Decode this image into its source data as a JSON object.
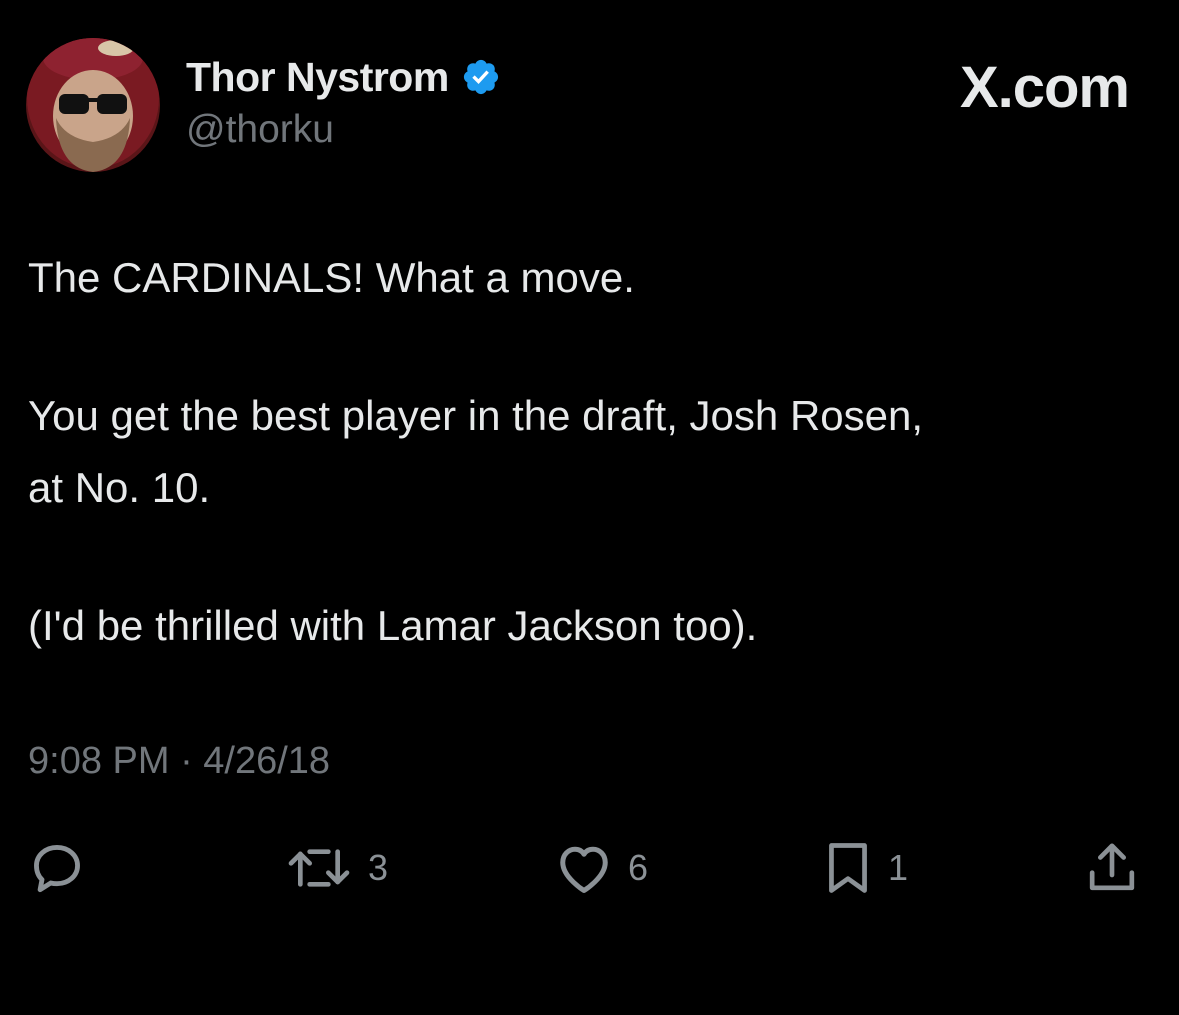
{
  "author": {
    "display_name": "Thor Nystrom",
    "handle": "@thorku",
    "verified": true,
    "verified_color": "#1d9bf0"
  },
  "brand": "X.com",
  "tweet": {
    "lines": [
      "The CARDINALS! What a move.",
      "You get the best player in the draft, Josh Rosen,",
      "at No. 10.",
      "(I'd be thrilled with Lamar Jackson too)."
    ],
    "timestamp": "9:08 PM · 4/26/18"
  },
  "actions": {
    "reply": {
      "icon": "reply-icon"
    },
    "retweet": {
      "icon": "retweet-icon",
      "count": "3"
    },
    "like": {
      "icon": "heart-icon",
      "count": "6"
    },
    "bookmark": {
      "icon": "bookmark-icon",
      "count": "1"
    },
    "share": {
      "icon": "share-icon"
    }
  },
  "colors": {
    "background": "#000000",
    "text": "#e7e9ea",
    "secondary_text": "#71767b"
  }
}
